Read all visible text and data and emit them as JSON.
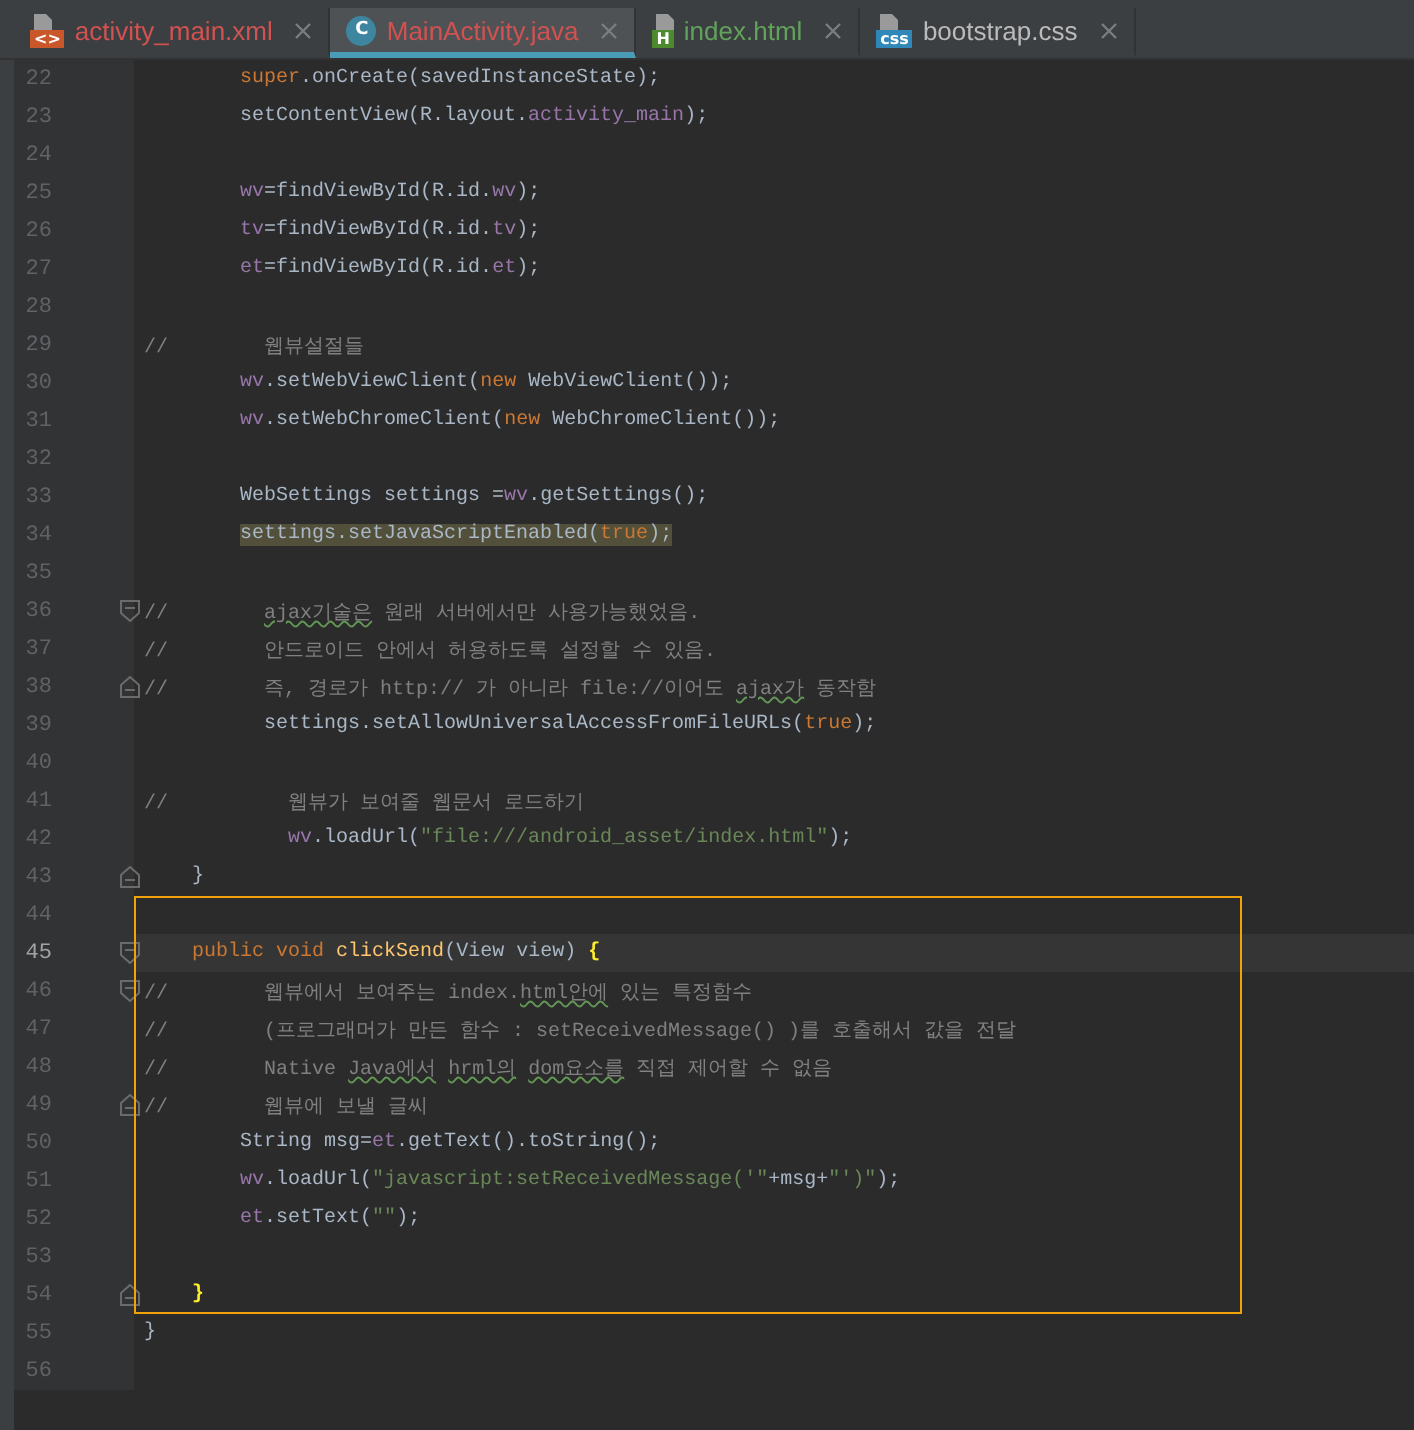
{
  "tabs": [
    {
      "label": "activity_main.xml",
      "kind": "xml",
      "badge": "<>",
      "color": "#d25252",
      "selected": false
    },
    {
      "label": "MainActivity.java",
      "kind": "class",
      "badge": "C",
      "color": "#d25252",
      "selected": true
    },
    {
      "label": "index.html",
      "kind": "html",
      "badge": "H",
      "color": "#62a35c",
      "selected": false
    },
    {
      "label": "bootstrap.css",
      "kind": "css",
      "badge": "css",
      "color": "#bbbbbb",
      "selected": false
    }
  ],
  "editor": {
    "lines": [
      {
        "number": "22",
        "tokens": [
          {
            "kind": "keyword",
            "text": "        super"
          },
          {
            "kind": "plain",
            "text": ".onCreate(savedInstanceState);"
          }
        ]
      },
      {
        "number": "23",
        "tokens": [
          {
            "kind": "plain",
            "text": "        setContentView(R.layout."
          },
          {
            "kind": "field",
            "text": "activity_main"
          },
          {
            "kind": "plain",
            "text": ");"
          }
        ]
      },
      {
        "number": "24"
      },
      {
        "number": "25",
        "tokens": [
          {
            "kind": "field",
            "text": "        wv"
          },
          {
            "kind": "plain",
            "text": "=findViewById(R.id."
          },
          {
            "kind": "field",
            "text": "wv"
          },
          {
            "kind": "plain",
            "text": ");"
          }
        ]
      },
      {
        "number": "26",
        "tokens": [
          {
            "kind": "field",
            "text": "        tv"
          },
          {
            "kind": "plain",
            "text": "=findViewById(R.id."
          },
          {
            "kind": "field",
            "text": "tv"
          },
          {
            "kind": "plain",
            "text": ");"
          }
        ]
      },
      {
        "number": "27",
        "tokens": [
          {
            "kind": "field",
            "text": "        et"
          },
          {
            "kind": "plain",
            "text": "=findViewById(R.id."
          },
          {
            "kind": "field",
            "text": "et"
          },
          {
            "kind": "plain",
            "text": ");"
          }
        ]
      },
      {
        "number": "28"
      },
      {
        "number": "29",
        "tokens": [
          {
            "kind": "comment",
            "text": "//        웹뷰설절들"
          }
        ]
      },
      {
        "number": "30",
        "tokens": [
          {
            "kind": "field",
            "text": "        wv"
          },
          {
            "kind": "plain",
            "text": ".setWebViewClient("
          },
          {
            "kind": "keyword",
            "text": "new"
          },
          {
            "kind": "plain",
            "text": " WebViewClient());"
          }
        ]
      },
      {
        "number": "31",
        "tokens": [
          {
            "kind": "field",
            "text": "        wv"
          },
          {
            "kind": "plain",
            "text": ".setWebChromeClient("
          },
          {
            "kind": "keyword",
            "text": "new"
          },
          {
            "kind": "plain",
            "text": " WebChromeClient());"
          }
        ]
      },
      {
        "number": "32"
      },
      {
        "number": "33",
        "tokens": [
          {
            "kind": "plain",
            "text": "        WebSettings settings ="
          },
          {
            "kind": "field",
            "text": "wv"
          },
          {
            "kind": "plain",
            "text": ".getSettings();"
          }
        ]
      },
      {
        "number": "34",
        "highlighted": true,
        "tokens": [
          {
            "kind": "plain",
            "text": "        settings.setJavaScriptEnabled("
          },
          {
            "kind": "keyword",
            "text": "true"
          },
          {
            "kind": "plain",
            "text": ");"
          }
        ]
      },
      {
        "number": "35"
      },
      {
        "number": "36",
        "fold_open": true,
        "tokens": [
          {
            "kind": "comment",
            "text": "//        "
          },
          {
            "kind": "typo",
            "text": "ajax기술은"
          },
          {
            "kind": "comment",
            "text": " 원래 서버에서만 사용가능했었음."
          }
        ]
      },
      {
        "number": "37",
        "tokens": [
          {
            "kind": "comment",
            "text": "//        안드로이드 안에서 허용하도록 설정할 수 있음."
          }
        ]
      },
      {
        "number": "38",
        "fold_close": true,
        "tokens": [
          {
            "kind": "comment",
            "text": "//        즉, 경로가 http:// 가 아니라 file://이어도 "
          },
          {
            "kind": "typo",
            "text": "ajax가"
          },
          {
            "kind": "comment",
            "text": " 동작함"
          }
        ]
      },
      {
        "number": "39",
        "tokens": [
          {
            "kind": "plain",
            "text": "          settings.setAllowUniversalAccessFromFileURLs("
          },
          {
            "kind": "keyword",
            "text": "true"
          },
          {
            "kind": "plain",
            "text": ");"
          }
        ]
      },
      {
        "number": "40"
      },
      {
        "number": "41",
        "tokens": [
          {
            "kind": "comment",
            "text": "//          웹뷰가 보여줄 웹문서 로드하기"
          }
        ]
      },
      {
        "number": "42",
        "tokens": [
          {
            "kind": "field",
            "text": "            wv"
          },
          {
            "kind": "plain",
            "text": ".loadUrl("
          },
          {
            "kind": "string",
            "text": "\"file:///android_asset/index.html\""
          },
          {
            "kind": "plain",
            "text": ");"
          }
        ]
      },
      {
        "number": "43",
        "fold_close": true,
        "tokens": [
          {
            "kind": "plain",
            "text": "    }"
          }
        ]
      }
    ],
    "selection": {
      "lines": [
        {
          "number": "44"
        },
        {
          "number": "45",
          "current": true,
          "fold_open": true,
          "tokens": [
            {
              "kind": "keyword",
              "text": "    public void "
            },
            {
              "kind": "method",
              "text": "clickSend"
            },
            {
              "kind": "plain",
              "text": "(View view) "
            },
            {
              "kind": "brace",
              "text": "{"
            }
          ]
        },
        {
          "number": "46",
          "fold_open": true,
          "tokens": [
            {
              "kind": "comment",
              "text": "//        웹뷰에서 보여주는 index."
            },
            {
              "kind": "typo",
              "text": "html안에"
            },
            {
              "kind": "comment",
              "text": " 있는 특정함수"
            }
          ]
        },
        {
          "number": "47",
          "tokens": [
            {
              "kind": "comment",
              "text": "//        (프로그래머가 만든 함수 : setReceivedMessage() )를 호출해서 값을 전달"
            }
          ]
        },
        {
          "number": "48",
          "tokens": [
            {
              "kind": "comment",
              "text": "//        Native "
            },
            {
              "kind": "typo",
              "text": "Java에서 "
            },
            {
              "kind": "typo",
              "text": "hrml의 "
            },
            {
              "kind": "typo",
              "text": "dom요소를"
            },
            {
              "kind": "comment",
              "text": " 직접 제어할 수 없음"
            }
          ]
        },
        {
          "number": "49",
          "fold_close": true,
          "tokens": [
            {
              "kind": "comment",
              "text": "//        웹뷰에 보낼 글씨"
            }
          ]
        },
        {
          "number": "50",
          "tokens": [
            {
              "kind": "plain",
              "text": "        String msg="
            },
            {
              "kind": "field",
              "text": "et"
            },
            {
              "kind": "plain",
              "text": ".getText().toString();"
            }
          ]
        },
        {
          "number": "51",
          "tokens": [
            {
              "kind": "field",
              "text": "        wv"
            },
            {
              "kind": "plain",
              "text": ".loadUrl("
            },
            {
              "kind": "string",
              "text": "\"javascript:setReceivedMessage('\""
            },
            {
              "kind": "plain",
              "text": "+msg+"
            },
            {
              "kind": "string",
              "text": "\"')\""
            },
            {
              "kind": "plain",
              "text": ");"
            }
          ]
        },
        {
          "number": "52",
          "tokens": [
            {
              "kind": "field",
              "text": "        et"
            },
            {
              "kind": "plain",
              "text": ".setText("
            },
            {
              "kind": "string",
              "text": "\"\""
            },
            {
              "kind": "plain",
              "text": ");"
            }
          ]
        },
        {
          "number": "53"
        },
        {
          "number": "54",
          "fold_close": true,
          "tokens": [
            {
              "kind": "brace",
              "text": "    }"
            }
          ]
        }
      ]
    },
    "lines_after": [
      {
        "number": "55",
        "tokens": [
          {
            "kind": "plain",
            "text": "}"
          }
        ]
      },
      {
        "number": "56"
      }
    ]
  }
}
